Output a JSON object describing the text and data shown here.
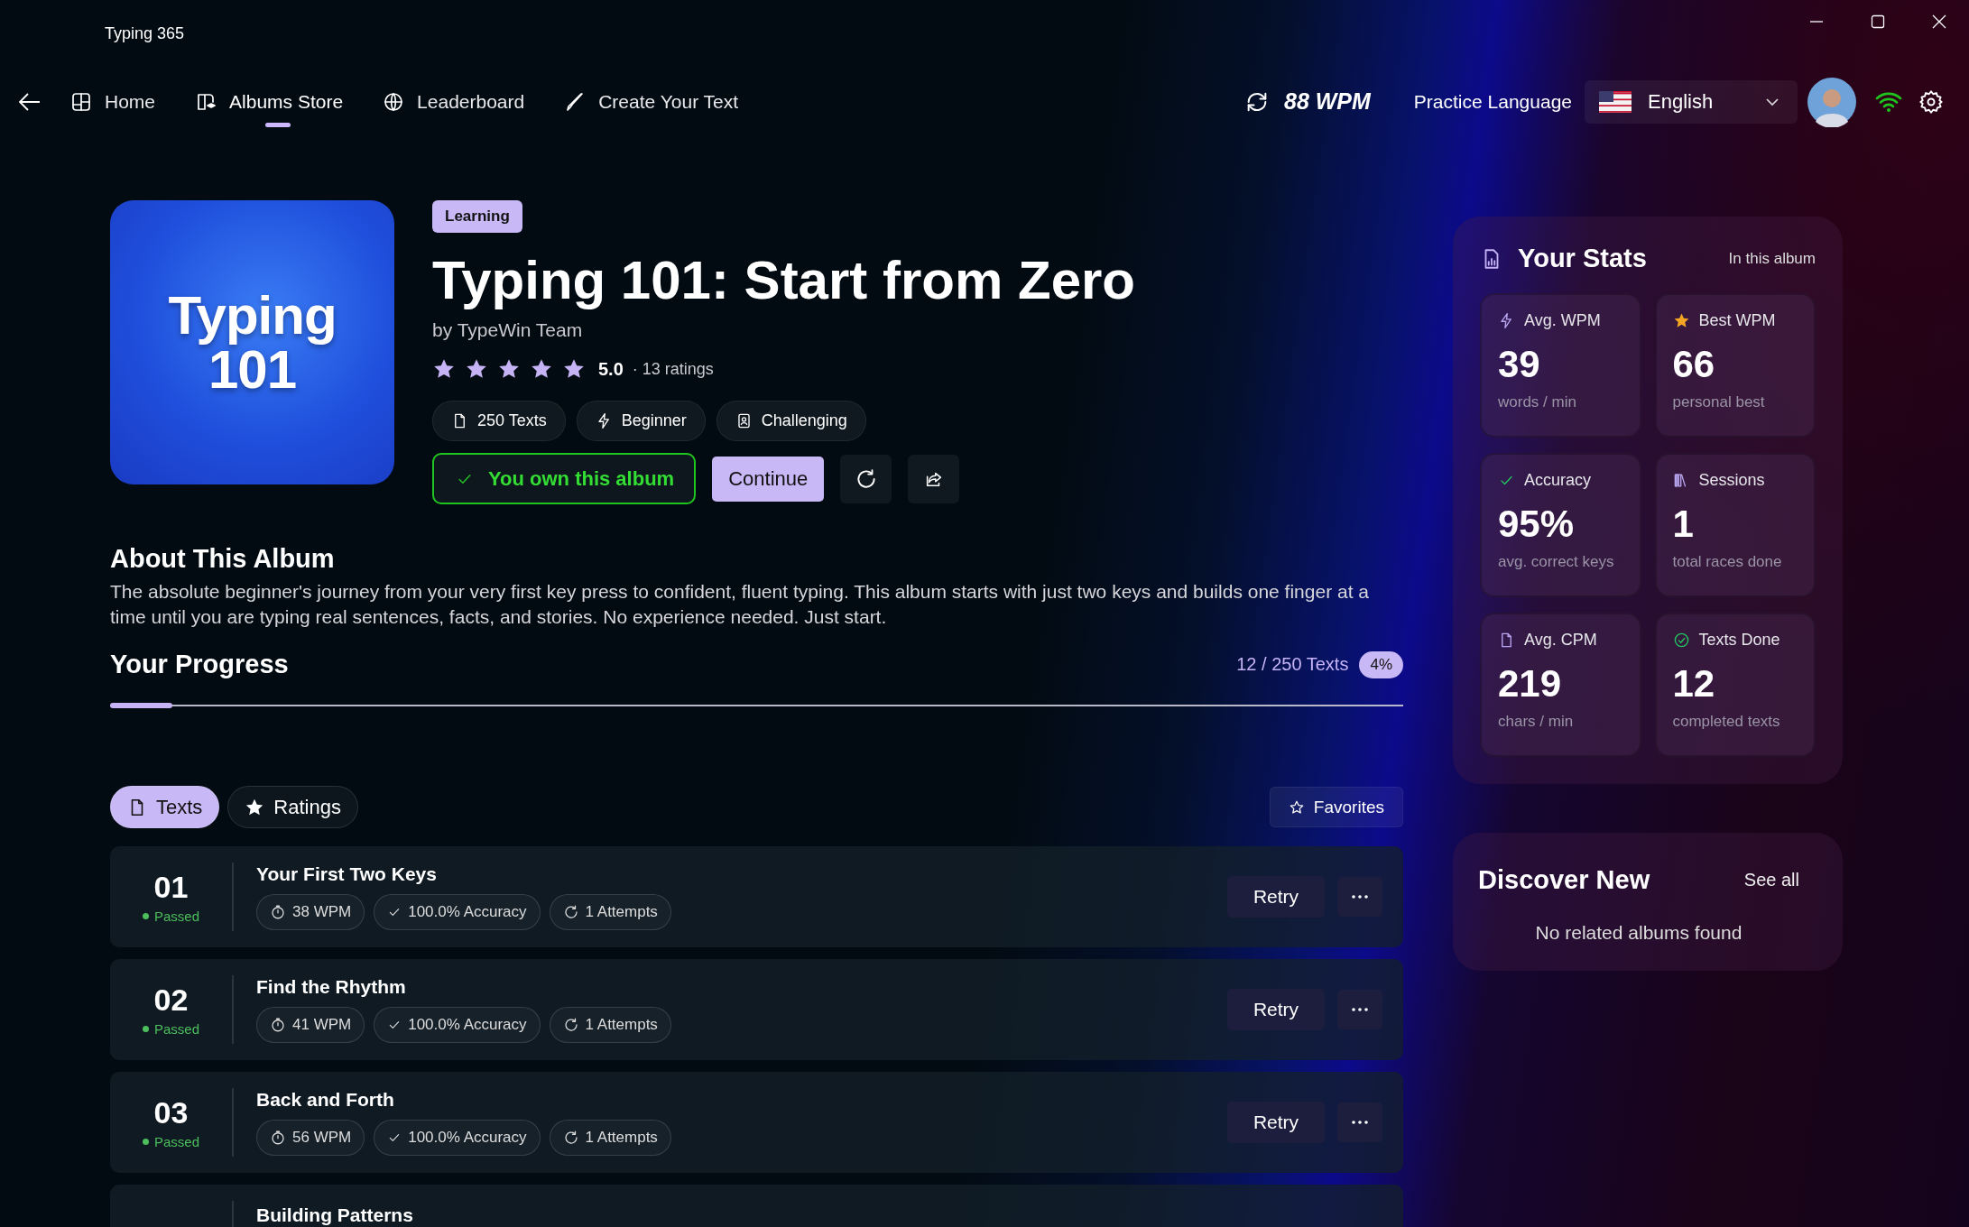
{
  "window": {
    "title": "Typing 365"
  },
  "nav": [
    {
      "label": "Home",
      "selected": false
    },
    {
      "label": "Albums Store",
      "selected": true
    },
    {
      "label": "Leaderboard",
      "selected": false
    },
    {
      "label": "Create Your Text",
      "selected": false
    }
  ],
  "toolbar": {
    "wpm": "88 WPM",
    "language_label": "Practice Language",
    "language": "English"
  },
  "album": {
    "cover_lines": [
      "Typing",
      "101"
    ],
    "tag": "Learning",
    "title": "Typing 101: Start from Zero",
    "author": "by TypeWin Team",
    "stars": 5,
    "rating": "5.0",
    "ratings_count": "· 13 ratings",
    "chips": [
      "250 Texts",
      "Beginner",
      "Challenging"
    ],
    "owned_label": "You own this album",
    "continue_label": "Continue"
  },
  "about": {
    "heading": "About This Album",
    "text": "The absolute beginner's journey from your very first key press to confident, fluent typing. This album starts with just two keys and builds one finger at a time until you are typing real sentences, facts, and stories. No experience needed. Just start."
  },
  "progress": {
    "heading": "Your Progress",
    "count": "12 / 250 Texts",
    "percent": "4%",
    "level": 0.048
  },
  "tabs": [
    {
      "label": "Texts",
      "selected": true
    },
    {
      "label": "Ratings",
      "selected": false
    }
  ],
  "favorites_label": "Favorites",
  "texts": [
    {
      "number": "01",
      "status": "Passed",
      "title": "Your First Two Keys",
      "wpm": "38 WPM",
      "accuracy": "100.0% Accuracy",
      "attempts": "1 Attempts",
      "action": "Retry"
    },
    {
      "number": "02",
      "status": "Passed",
      "title": "Find the Rhythm",
      "wpm": "41 WPM",
      "accuracy": "100.0% Accuracy",
      "attempts": "1 Attempts",
      "action": "Retry"
    },
    {
      "number": "03",
      "status": "Passed",
      "title": "Back and Forth",
      "wpm": "56 WPM",
      "accuracy": "100.0% Accuracy",
      "attempts": "1 Attempts",
      "action": "Retry"
    },
    {
      "title": "Building Patterns"
    }
  ],
  "stats": {
    "heading": "Your Stats",
    "scope": "In this album",
    "cards": [
      {
        "label": "Avg. WPM",
        "value": "39",
        "caption": "words / min"
      },
      {
        "label": "Best WPM",
        "value": "66",
        "caption": "personal best"
      },
      {
        "label": "Accuracy",
        "value": "95%",
        "caption": "avg. correct keys"
      },
      {
        "label": "Sessions",
        "value": "1",
        "caption": "total races done"
      },
      {
        "label": "Avg. CPM",
        "value": "219",
        "caption": "chars / min"
      },
      {
        "label": "Texts Done",
        "value": "12",
        "caption": "completed texts"
      }
    ]
  },
  "discover": {
    "heading": "Discover New",
    "link": "See all",
    "empty": "No related albums found"
  }
}
